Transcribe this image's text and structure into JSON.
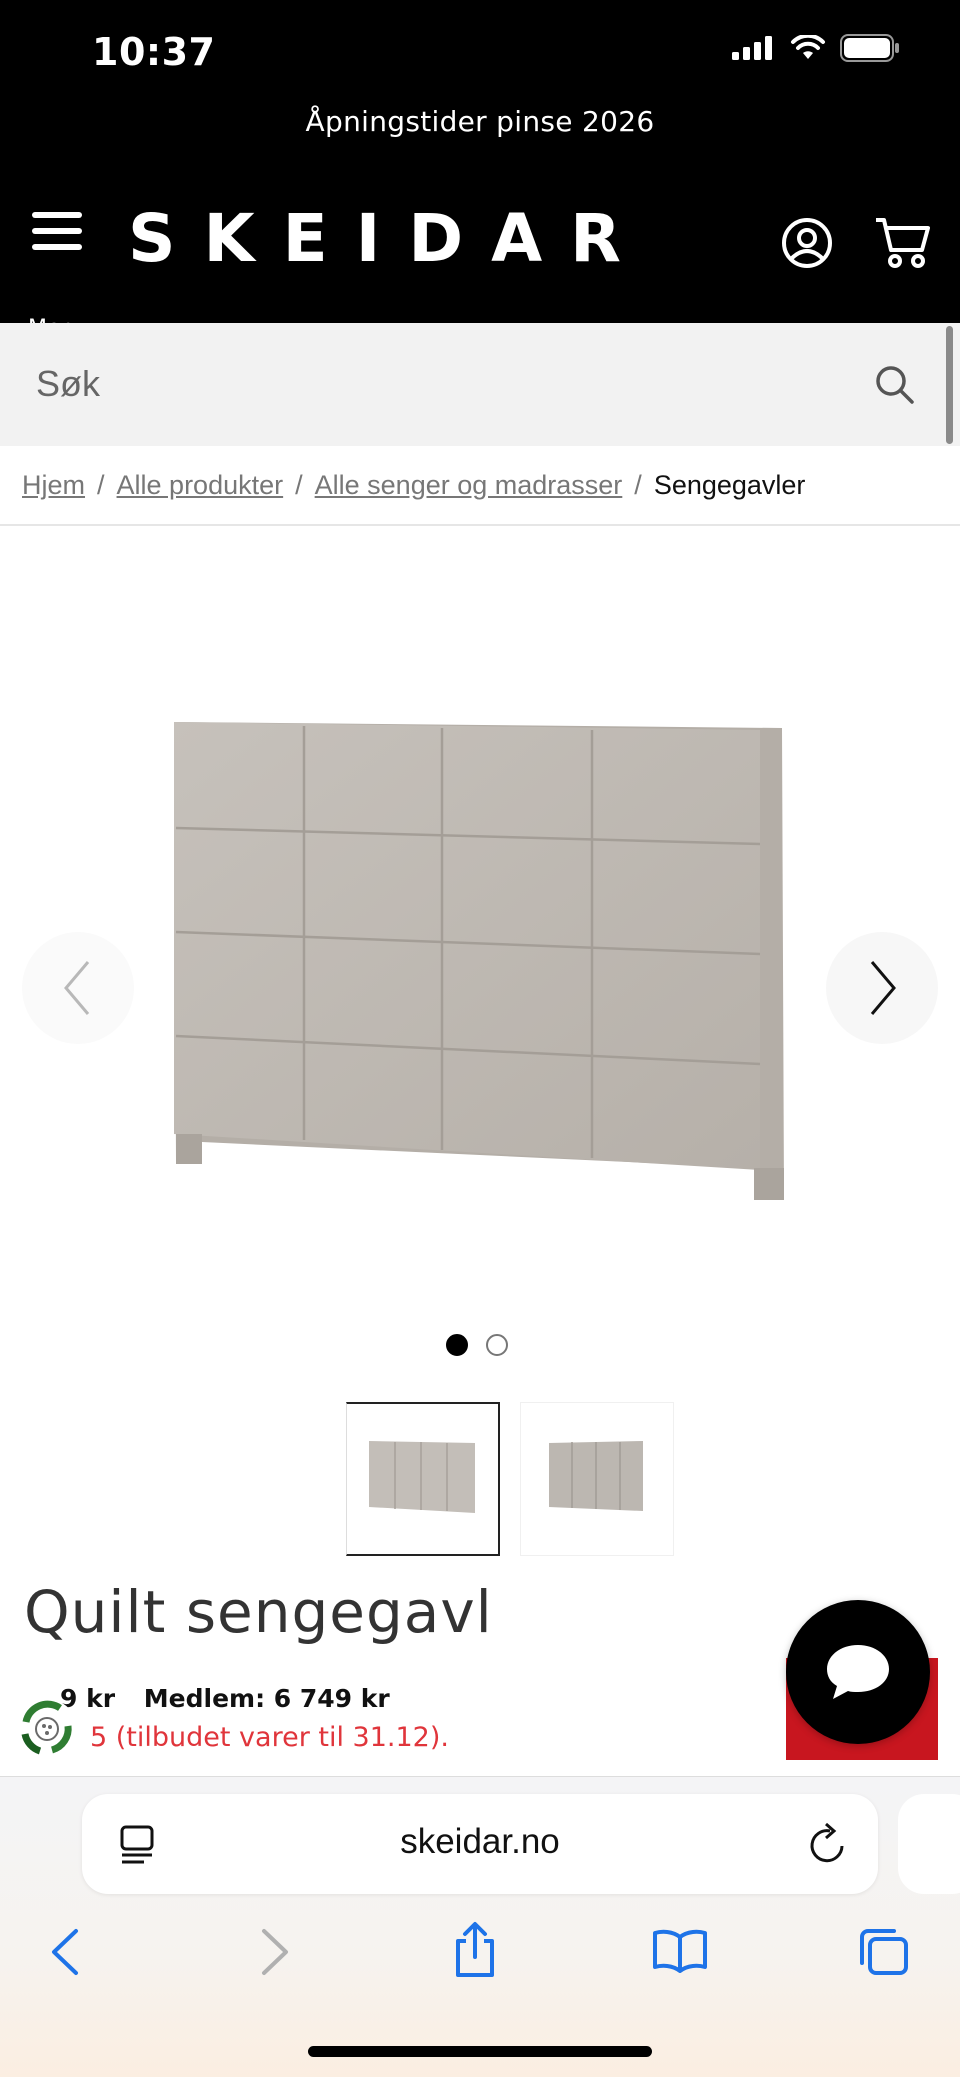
{
  "status_bar": {
    "time": "10:37"
  },
  "promo": {
    "text": "Åpningstider pinse 2026"
  },
  "header": {
    "logo": "SKEIDAR",
    "menu_label": "Meny"
  },
  "search": {
    "placeholder": "Søk"
  },
  "breadcrumb": {
    "items": [
      "Hjem",
      "Alle produkter",
      "Alle senger og madrasser"
    ],
    "current": "Sengegavler"
  },
  "gallery": {
    "image_count": 2,
    "active_index": 0
  },
  "product": {
    "title": "Quilt sengegavl",
    "price_partial": "9 kr",
    "member_price": "Medlem: 6 749 kr",
    "offer_text": "5 (tilbudet varer til 31.12)."
  },
  "browser": {
    "url": "skeidar.no"
  },
  "colors": {
    "header_bg": "#000000",
    "offer_red": "#e0353b",
    "fabric": "#bdb7b0"
  },
  "icons": [
    "menu-icon",
    "account-icon",
    "cart-icon",
    "search-icon",
    "chevron-left-icon",
    "chevron-right-icon",
    "chat-icon",
    "recycle-icon",
    "reader-icon",
    "reload-icon",
    "back-icon",
    "forward-icon",
    "share-icon",
    "bookmarks-icon",
    "tabs-icon"
  ]
}
